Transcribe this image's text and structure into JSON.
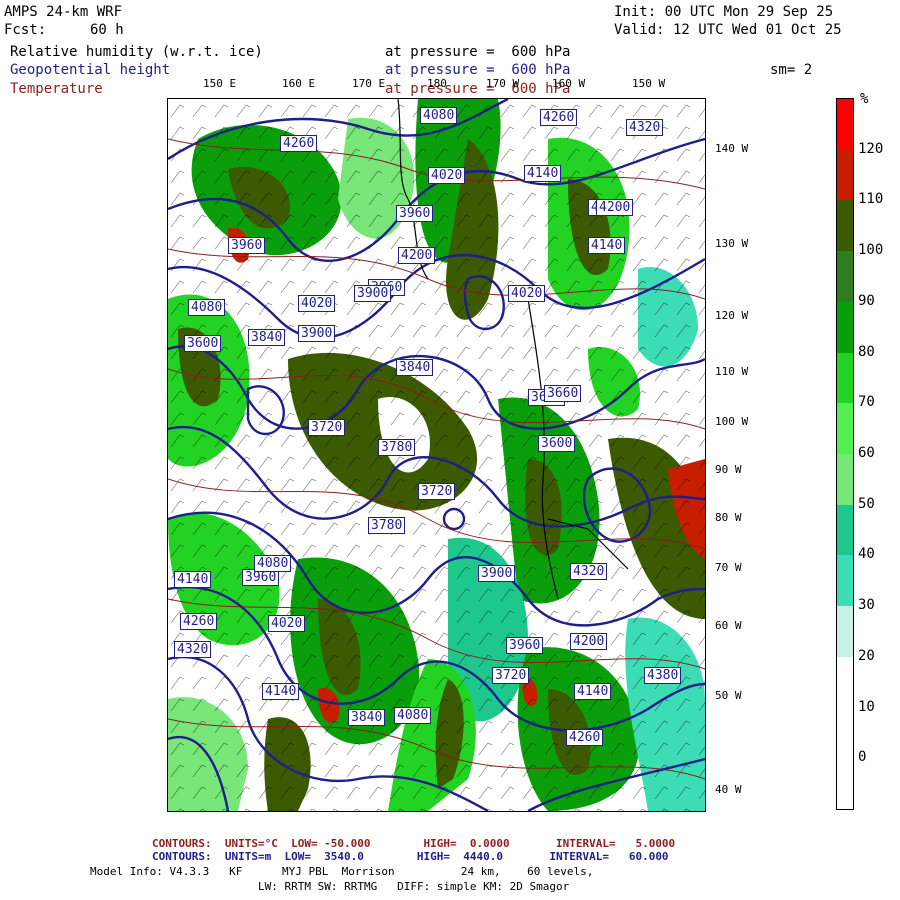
{
  "header": {
    "model": "AMPS 24-km WRF",
    "fcst_label": "Fcst:",
    "fcst_value": "60 h",
    "init": "Init: 00 UTC Mon 29 Sep 25",
    "valid": "Valid: 12 UTC Wed 01 Oct 25",
    "fields": [
      {
        "name": "Relative humidity (w.r.t. ice)",
        "level": "at pressure =  600 hPa",
        "color": "#000000"
      },
      {
        "name": "Geopotential height",
        "level": "at pressure =  600 hPa",
        "color": "#1e1e8c"
      },
      {
        "name": "Temperature",
        "level": "at pressure =  600 hPa",
        "color": "#8c1e1e"
      }
    ],
    "smoothing": "sm= 2"
  },
  "map": {
    "lon_labels_top": [
      "150 E",
      "160 E",
      "170 E",
      "180",
      "170 W",
      "160 W",
      "150 W"
    ],
    "lat_labels_right": [
      "140 W",
      "130 W",
      "120 W",
      "110 W",
      "100 W",
      "90 W",
      "80 W",
      "70 W",
      "60 W",
      "50 W",
      "40 W"
    ],
    "height_labels": [
      "4260",
      "4320",
      "4260",
      "4080",
      "4020",
      "3960",
      "4140",
      "4080",
      "4200",
      "4140",
      "3960",
      "4020",
      "3900",
      "3840",
      "4080",
      "3960",
      "4020",
      "3840",
      "3780",
      "3720",
      "3660",
      "3600",
      "3780",
      "3720",
      "3900",
      "3960",
      "4140",
      "4020",
      "4260",
      "4080",
      "4320",
      "4140",
      "3840",
      "4080",
      "4260",
      "4200",
      "4320",
      "4380",
      "4140",
      "3960",
      "4200",
      "3660",
      "3720",
      "3600",
      "3900"
    ]
  },
  "colorbar": {
    "unit": "%",
    "ticks": [
      "120",
      "110",
      "100",
      "90",
      "80",
      "70",
      "60",
      "50",
      "40",
      "30",
      "20",
      "10",
      "0"
    ],
    "colors": [
      "#ff0000",
      "#c81e00",
      "#3c5a00",
      "#2e7d1e",
      "#0a9f0a",
      "#23d323",
      "#50f050",
      "#78e678",
      "#1ec88c",
      "#3cdcb4",
      "#c8f0e6",
      "#ffffff",
      "#ffffff",
      "#ffffff"
    ]
  },
  "footer": {
    "temp_contours": "CONTOURS:  UNITS=°C  LOW= -50.000        HIGH=  0.0000       INTERVAL=   5.0000",
    "height_contours": "CONTOURS:  UNITS=m  LOW=  3540.0        HIGH=  4440.0       INTERVAL=   60.000",
    "model_info_1": "Model Info: V4.3.3   KF      MYJ PBL  Morrison          24 km,    60 levels,",
    "model_info_2": "LW: RRTM SW: RRTMG   DIFF: simple KM: 2D Smagor"
  }
}
